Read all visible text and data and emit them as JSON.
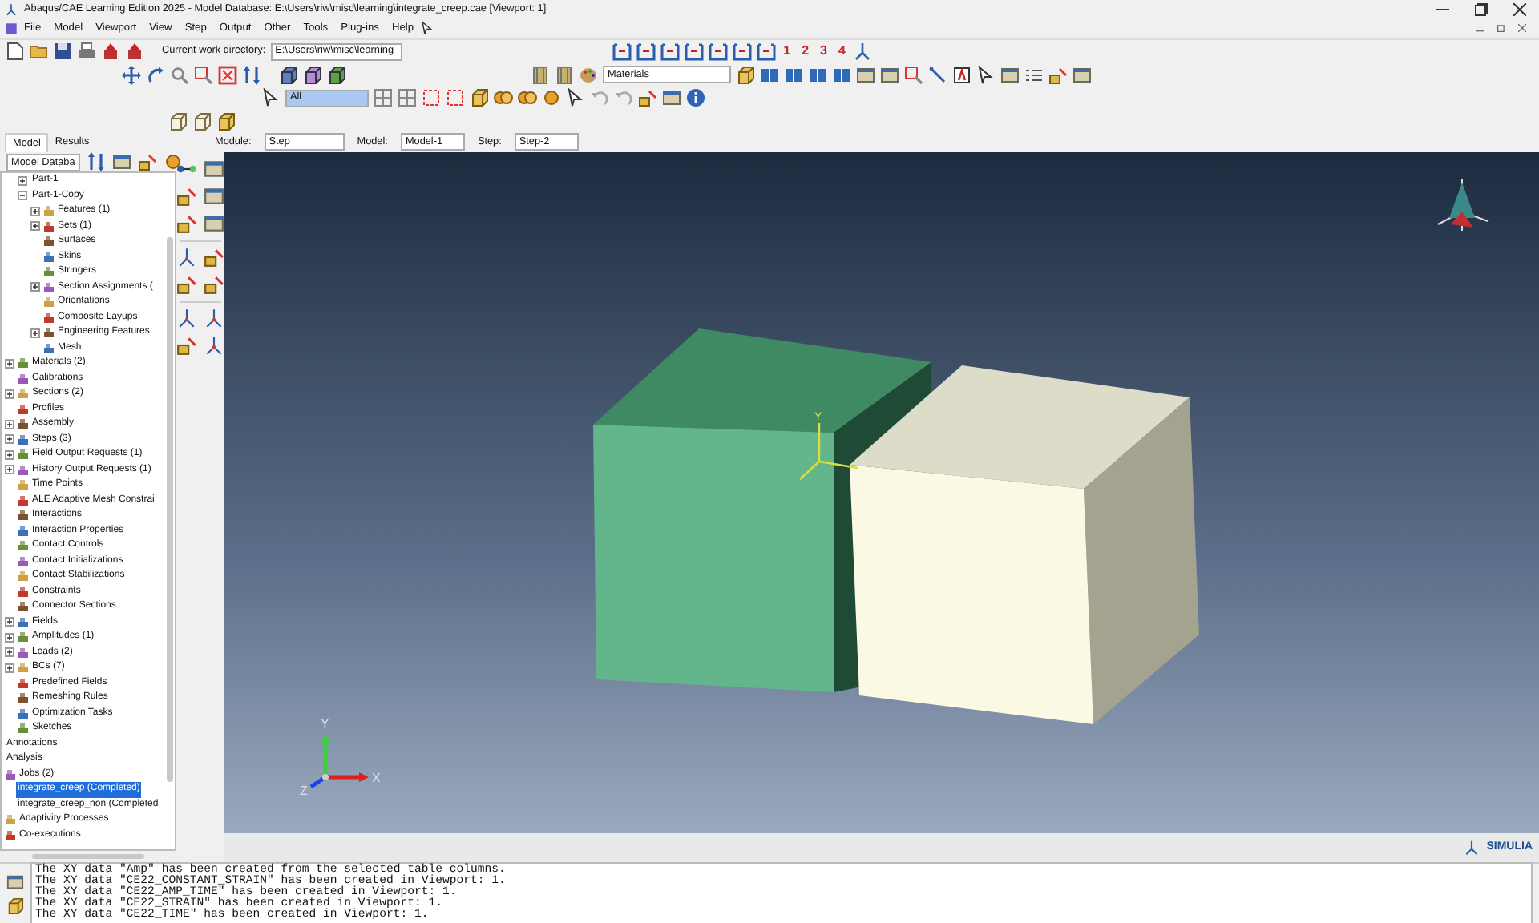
{
  "window": {
    "title": "Abaqus/CAE Learning Edition 2025 - Model Database: E:\\Users\\riw\\misc\\learning\\integrate_creep.cae [Viewport: 1]"
  },
  "menu": [
    "File",
    "Model",
    "Viewport",
    "View",
    "Step",
    "Output",
    "Other",
    "Tools",
    "Plug-ins",
    "Help"
  ],
  "toolbar": {
    "work_directory_label": "Current work directory:",
    "work_directory": "E:\\Users\\riw\\misc\\learning",
    "viewport_numbers": [
      "1",
      "2",
      "3",
      "4"
    ],
    "materials": "Materials",
    "selection_filter": "All"
  },
  "panel_tabs": [
    {
      "label": "Model",
      "selected": true
    },
    {
      "label": "Results",
      "selected": false
    }
  ],
  "context_bar": [
    {
      "label": "Module:",
      "value": "Step"
    },
    {
      "label": "Model:",
      "value": "Model-1"
    },
    {
      "label": "Step:",
      "value": "Step-2"
    }
  ],
  "tree": {
    "combo": "Model Databa",
    "parts": [
      {
        "label": "Part-1",
        "expanded": false,
        "selected": false
      },
      {
        "label": "Part-1-Copy",
        "expanded": true,
        "selected": false,
        "children": [
          {
            "label": "Features (1)",
            "expanded": false,
            "selected": false
          },
          {
            "label": "Sets (1)",
            "expanded": false,
            "selected": false
          },
          {
            "label": "Surfaces",
            "selected": false
          },
          {
            "label": "Skins",
            "selected": false
          },
          {
            "label": "Stringers",
            "selected": false
          },
          {
            "label": "Section Assignments (",
            "expanded": false,
            "selected": false
          },
          {
            "label": "Orientations",
            "selected": false
          },
          {
            "label": "Composite Layups",
            "selected": false
          },
          {
            "label": "Engineering Features",
            "expanded": false,
            "selected": false
          },
          {
            "label": "Mesh",
            "selected": false
          }
        ]
      }
    ],
    "items": [
      {
        "label": "Materials (2)",
        "expanded": false,
        "selected": false
      },
      {
        "label": "Calibrations",
        "selected": false
      },
      {
        "label": "Sections (2)",
        "expanded": false,
        "selected": false
      },
      {
        "label": "Profiles",
        "selected": false
      },
      {
        "label": "Assembly",
        "expanded": false,
        "selected": false
      },
      {
        "label": "Steps (3)",
        "expanded": false,
        "selected": false
      },
      {
        "label": "Field Output Requests (1)",
        "expanded": false,
        "selected": false
      },
      {
        "label": "History Output Requests (1)",
        "expanded": false,
        "selected": false
      },
      {
        "label": "Time Points",
        "selected": false
      },
      {
        "label": "ALE Adaptive Mesh Constrai",
        "selected": false
      },
      {
        "label": "Interactions",
        "selected": false
      },
      {
        "label": "Interaction Properties",
        "selected": false
      },
      {
        "label": "Contact Controls",
        "selected": false
      },
      {
        "label": "Contact Initializations",
        "selected": false
      },
      {
        "label": "Contact Stabilizations",
        "selected": false
      },
      {
        "label": "Constraints",
        "selected": false
      },
      {
        "label": "Connector Sections",
        "selected": false
      },
      {
        "label": "Fields",
        "expanded": false,
        "selected": false
      },
      {
        "label": "Amplitudes (1)",
        "expanded": false,
        "selected": false
      },
      {
        "label": "Loads (2)",
        "expanded": false,
        "selected": false
      },
      {
        "label": "BCs (7)",
        "expanded": false,
        "selected": false
      },
      {
        "label": "Predefined Fields",
        "selected": false
      },
      {
        "label": "Remeshing Rules",
        "selected": false
      },
      {
        "label": "Optimization Tasks",
        "selected": false
      },
      {
        "label": "Sketches",
        "selected": false
      }
    ],
    "analysis": [
      {
        "kind": "heading",
        "label": "Annotations",
        "selected": false
      },
      {
        "kind": "heading",
        "label": "Analysis",
        "selected": false
      },
      {
        "kind": "node",
        "label": "Jobs (2)",
        "selected": false,
        "children": [
          {
            "label": "integrate_creep (Completed)",
            "selected": true
          },
          {
            "label": "integrate_creep_non (Completed",
            "selected": false
          }
        ]
      },
      {
        "kind": "node",
        "label": "Adaptivity Processes",
        "selected": false
      },
      {
        "kind": "node",
        "label": "Co-executions",
        "selected": false
      }
    ]
  },
  "viewport": {
    "model_axis_label": "Y",
    "triad": {
      "y": "Y",
      "x": "X",
      "z": "Z"
    }
  },
  "logo": "SIMULIA",
  "messages": [
    "The XY data \"Amp\" has been created from the selected table columns.",
    "The XY data \"CE22_CONSTANT_STRAIN\" has been created in Viewport: 1.",
    "The XY data \"CE22_AMP_TIME\" has been created in Viewport: 1.",
    "The XY data \"CE22_STRAIN\" has been created in Viewport: 1.",
    "The XY data \"CE22_TIME\" has been created in Viewport: 1."
  ]
}
